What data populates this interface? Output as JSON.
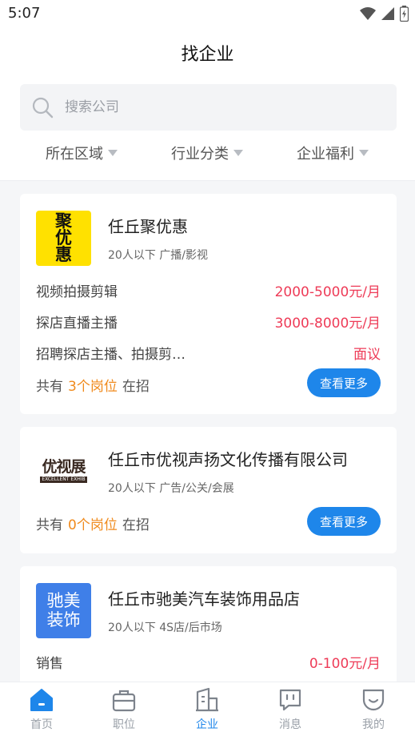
{
  "status_bar": {
    "time": "5:07"
  },
  "header": {
    "title": "找企业",
    "search_placeholder": "搜索公司",
    "filters": [
      {
        "label": "所在区域"
      },
      {
        "label": "行业分类"
      },
      {
        "label": "企业福利"
      }
    ]
  },
  "companies": [
    {
      "name": "任丘聚优惠",
      "meta": "20人以下  广播/影视",
      "logo_text": [
        "聚",
        "优",
        "惠"
      ],
      "logo_bg": "#ffe100",
      "jobs": [
        {
          "title": "视频拍摄剪辑",
          "salary": "2000-5000元/月"
        },
        {
          "title": "探店直播主播",
          "salary": "3000-8000元/月"
        },
        {
          "title": "招聘探店主播、拍摄剪…",
          "salary": "面议"
        }
      ],
      "summary_prefix": "共有",
      "summary_count": "3个岗位",
      "summary_suffix": "在招",
      "more_label": "查看更多"
    },
    {
      "name": "任丘市优视声扬文化传播有限公司",
      "meta": "20人以下  广告/公关/会展",
      "logo_text": [
        "优视展",
        "EXCELLENT EXHIB"
      ],
      "logo_bg": "#ffffff",
      "jobs": [],
      "summary_prefix": "共有",
      "summary_count": "0个岗位",
      "summary_suffix": "在招",
      "more_label": "查看更多"
    },
    {
      "name": "任丘市驰美汽车装饰用品店",
      "meta": "20人以下  4S店/后市场",
      "logo_text": [
        "驰美",
        "装饰"
      ],
      "logo_bg": "#3f7fe8",
      "jobs": [
        {
          "title": "销售",
          "salary": "0-100元/月"
        }
      ]
    }
  ],
  "tabbar": {
    "items": [
      {
        "label": "首页",
        "icon": "home-icon"
      },
      {
        "label": "职位",
        "icon": "briefcase-icon"
      },
      {
        "label": "企业",
        "icon": "building-icon",
        "active": true
      },
      {
        "label": "消息",
        "icon": "message-icon"
      },
      {
        "label": "我的",
        "icon": "profile-icon"
      }
    ]
  },
  "colors": {
    "accent": "#1e86ea",
    "salary": "#ee3b57",
    "count": "#f08a1c"
  }
}
